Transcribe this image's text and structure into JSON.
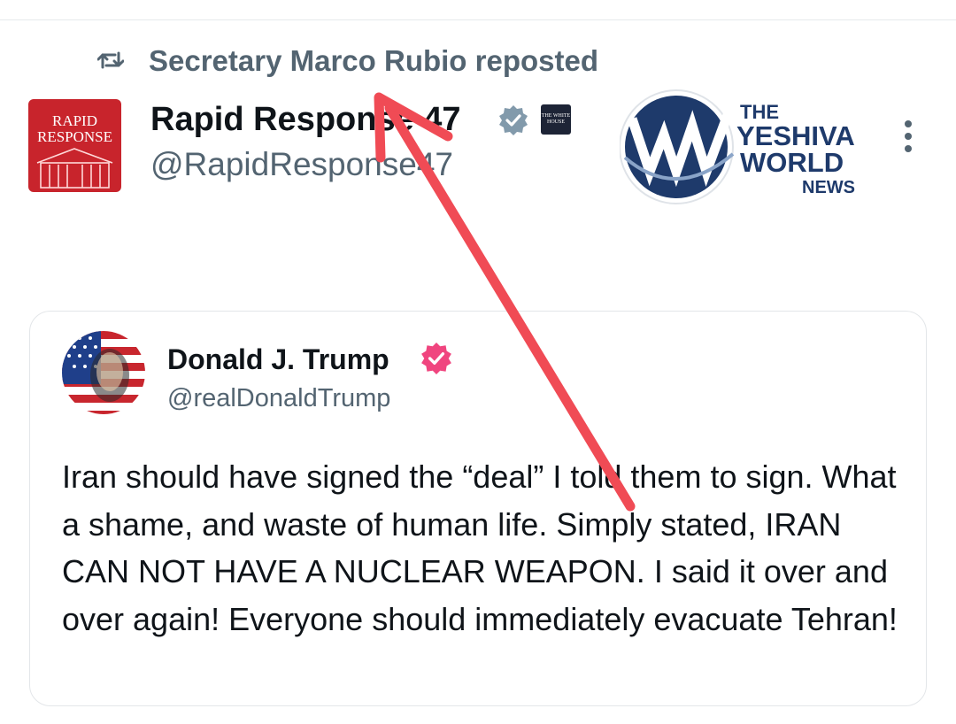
{
  "repost": {
    "text": "Secretary Marco Rubio reposted",
    "icon": "repost-icon"
  },
  "author": {
    "name": "Rapid Response 47",
    "handle": "@RapidResponse47",
    "avatar_text_line1": "RAPID",
    "avatar_text_line2": "RESPONSE",
    "affiliate_badge": "THE WHITE HOUSE",
    "verified_color": "#829aab"
  },
  "watermark": {
    "line1": "THE",
    "line2": "YESHIVA",
    "line3": "WORLD",
    "line4": "NEWS"
  },
  "quoted_post": {
    "name": "Donald J. Trump",
    "handle": "@realDonaldTrump",
    "verified_color": "#f0457f",
    "text": "Iran should have signed the “deal” I told them to sign. What a shame, and waste of human life. Simply stated, IRAN CAN NOT HAVE A NUCLEAR WEAPON. I said it over and over again! Everyone should immediately evacuate Tehran!"
  },
  "colors": {
    "secondary_text": "#536471",
    "primary_text": "#0f1419",
    "annotation_arrow": "#f04b55",
    "rr_avatar_bg": "#c8242c",
    "ywn_blue": "#1e3a6b"
  }
}
